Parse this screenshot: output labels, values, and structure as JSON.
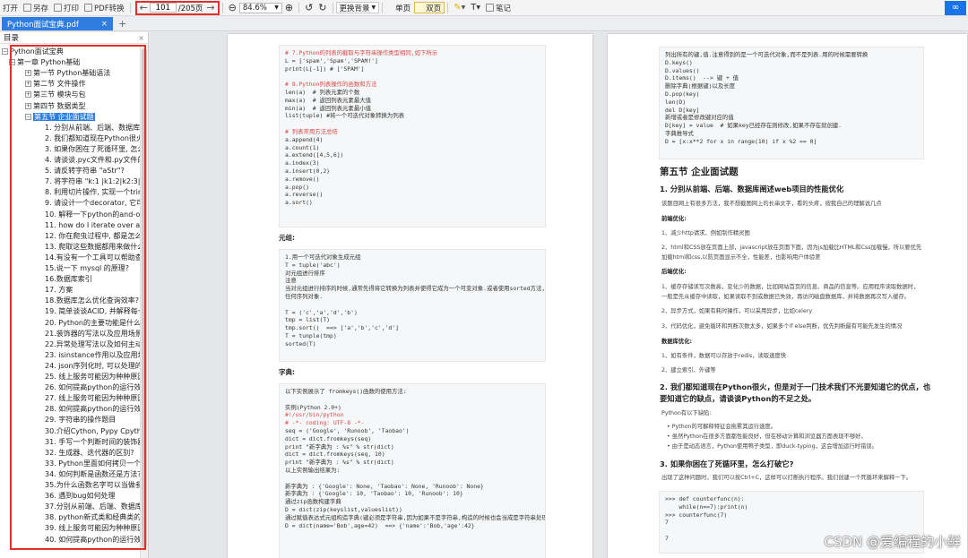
{
  "toolbar": {
    "open": "打开",
    "save_as": "另存",
    "print": "打印",
    "pdf_convert": "PDF转换",
    "current_page": "101",
    "total_pages": "/205页",
    "zoom": "84.6%",
    "background": "更换背景",
    "single_page": "单页",
    "double_page": "双页",
    "notes": "笔记"
  },
  "tab": {
    "title": "Python面试宝典.pdf",
    "close": "×",
    "add": "+"
  },
  "sidebar": {
    "header": "目录",
    "items": [
      "Python面试宝典",
      "第一章 Python基础",
      "第一节 Python基础语法",
      "第二节 文件操作",
      "第三节 模块与包",
      "第四节 数据类型",
      "第五节 企业面试题",
      "1. 分别从前端、后端、数据库阐",
      "2. 我们都知道现在Python很火,",
      "3. 如果你困在了死循环里, 怎么",
      "4. 请谈谈.pyc文件和.py文件的不",
      "5. 请反转字符串 \"aStr\"?",
      "7. 将字符串 \"k:1 |k1:2|k2:3|k3:",
      "8. 利用切片操作, 实现一个trim(",
      "9. 请设计一个decorator, 它可作",
      "10. 解释一下python的and-or语",
      "11. how do I iterate over a se",
      "12. 你在爬虫过程中, 都是怎么处",
      "13. 爬取这些数据都用来做什么?",
      "14.有没有一个工具可以帮助查找",
      "15.说一下 mysql 的原理?",
      "16.数据库索引",
      "17. 方案",
      "18.数据库怎么优化查询效率?",
      "19. 简单谈谈ACID, 并解释每一个",
      "20. Python的主要功能是什么?",
      "21.装饰器的写法以及应用场景",
      "22.异常处理写法以及如何主动抛",
      "23. isinstance作用以及应用场景",
      "24. json序列化时, 可以处理的数",
      "25. 线上服务可能因为种种原因导",
      "26. 如何提高python的运行效率",
      "27. 线上服务可能因为种种原因导",
      "28. 如何提高python的运行效率",
      "29. 字符串的操作题目",
      "30.介绍Cython, Pypy Cpython",
      "31. 手写一个判断时间的装饰器",
      "32. 生成器、迭代器的区别?",
      "33. Python里面如何拷贝一个对象",
      "34. 如何判断是函数还是方法?",
      "35.为什么函数名字可以当做参数",
      "36. 遇到bug如何处理",
      "37.分别从前端、后端、数据库阐",
      "38. python新式类和经典类的区别",
      "39. 线上服务可能因为种种原因导",
      "40. 如何提高python的运行效率"
    ]
  },
  "page1": {
    "code1": [
      "# 7.Python的列表的截取与字符串操作类型相同,如下所示",
      "L = ['spam','Spam','SPAM!']",
      "print(L[-1]) # ['SPAM']",
      "",
      "# 8.Python列表操作的函数和方法",
      "len(a)  # 列表元素的个数",
      "max(a)  # 返回列表元素最大值",
      "min(a)  # 返回列表元素最小值",
      "list(tuple) #将一个可迭代对象转换为列表",
      "",
      "# 列表常用方法总结",
      "a.append(4)",
      "a.count(1)",
      "a.extend([4,5,6])",
      "a.index(3)",
      "a.insert(0,2)",
      "a.remove()",
      "a.pop()",
      "a.reverse()",
      "a.sort()"
    ],
    "label_tuple": "元组:",
    "code2": [
      "1.用一个可迭代对象生成元组",
      "T = tuple('abc')",
      "对元组进行排序",
      "注意",
      "当对元组进行排序的时候,通常先得将它转换为列表并使得它成为一个可变对象.或者使用sorted方法,它接收",
      "任何序列对象.",
      "",
      "T = ('c','a','d','b')",
      "tmp = list(T)",
      "tmp.sort()  ==> ['a','b','c','d']",
      "T = tunple(tmp)",
      "sorted(T)"
    ],
    "label_dict": "字典:",
    "code3": [
      "以下实例展示了 fromkeys()函数的使用方法:",
      "",
      "实例(Python 2.0+)",
      "#!/usr/bin/python",
      "# -*- coding: UTF-8 -*-",
      "seq = ('Google', 'Runoob', 'Taobao')",
      "dict = dict.fromkeys(seq)",
      "print \"新字典为 : %s\" % str(dict)",
      "dict = dict.fromkeys(seq, 10)",
      "print \"新字典为 : %s\" % str(dict)",
      "以上实例输出结果为:",
      "",
      "新字典为 : {'Google': None, 'Taobao': None, 'Runoob': None}",
      "新字典为 : {'Google': 10, 'Taobao': 10, 'Runoob': 10}",
      "通过zip函数构建字典",
      "D = dict(zip(keyslist,valueslist))",
      "通过赋值表达式元组构造字典(键必须是字符串,因为如果不是字符串,构造的时候也会当成是字符串处理)",
      "D = dict(name='Bob',age=42)  ==> {'name':'Bob,'age':42}"
    ]
  },
  "page2": {
    "code1": [
      "列出所有的键,值.注意得到的是一个可迭代对象,而不是列表.用的时候需要转换",
      "D.keys()",
      "D.values()",
      "D.items()  --> 键 + 值",
      "删除字典(根据键)以及长度",
      "D.pop(key)",
      "len(D)",
      "del D[key]",
      "新增或者是修改键对应的值",
      "D[key] = value  # 如果key已经存在则修改,如果不存在就创建.",
      "字典推导式",
      "D = [x:x**2 for x in range(10) if x %2 == 0]"
    ],
    "section_title": "第五节 企业面试题",
    "q1_title": "1. 分别从前端、后端、数据库阐述web项目的性能优化",
    "q1_intro": "该题目网上有很多方法，我不想截图网上的长串文字，看的头疼，按我自己的理解说几点",
    "frontend": "前端优化:",
    "f1": "1、减少http请求、例如制作精灵图",
    "f2": "2、html和CSS放在页面上部，javascript放在页面下面，因为js加载比HTML和Css加载慢，所以要优先",
    "f2b": "加载html和css,以防页面显示不全，性能差，也影响用户体验差",
    "backend": "后端优化:",
    "b1": "1、缓存存储读写次数高，变化少的数据，比如网站首页的信息、商品的信息等。应用程序读取数据时，",
    "b1b": "一般是先从缓存中读取，如果读取不到或数据已失效，再访问磁盘数据库，并将数据再次写入缓存。",
    "b2": "2、异步方式，如果有耗时操作，可以采用异步，比如celery",
    "b3": "3、代码优化，避免循环和判断次数太多，如果多个if else判断，优先判断最有可能先发生的情况",
    "database": "数据库优化:",
    "d1": "1、如有条件，数据可以存放于redis，读取速度快",
    "d2": "2、建立索引、外键等",
    "q2_title_a": "2. 我们都知道现在Python很火，但是对于一门技术我们不光要知道它的优点，也",
    "q2_title_b": "要知道它的缺点，请谈谈Python的不足之处。",
    "q2_intro": "Python有以下缺陷:",
    "q2_b1": "Python的可解释特征会拖累其运行速度。",
    "q2_b2": "虽然Python在很多方面都性能良好，但在移动计算和浏览器方面表现不够好。",
    "q2_b3": "由于是动态语言，Python使用鸭子类型，即duck-typing，这会增加运行时错误。",
    "q3_title": "3. 如果你困在了死循环里，怎么打破它?",
    "q3_intro": "出现了这种问题时，我们可以按Ctrl+C，这样可以打断执行程序。我们创建一个死循环来解释一下。",
    "code2": [
      ">>> def counterfunc(n):",
      "    while(n==7):print(n)",
      ">>> counterfunc(7)",
      "7",
      "",
      "7"
    ]
  },
  "watermark": "CSDN @爱编程的小鲜"
}
